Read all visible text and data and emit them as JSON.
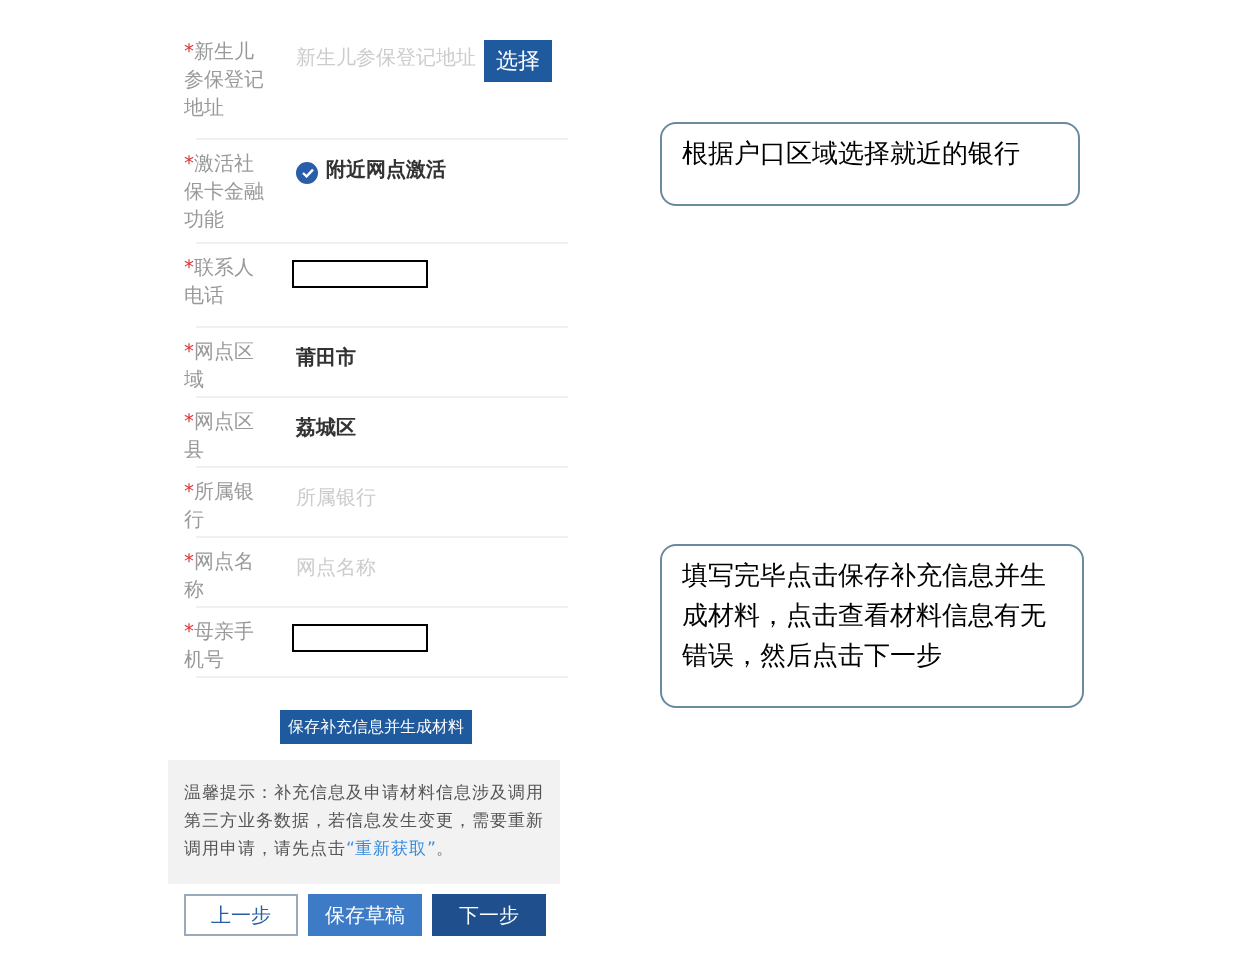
{
  "fields": [
    {
      "kind": "address",
      "marker": "*",
      "label": "新生儿参保登记地址",
      "placeholder": "新生儿参保登记地址",
      "button": "选择"
    },
    {
      "kind": "radio",
      "marker": "*",
      "label": "激活社保卡金融功能",
      "option": "附近网点激活",
      "checked": true
    },
    {
      "kind": "input",
      "marker": "*",
      "label": "联系人电话"
    },
    {
      "kind": "value",
      "marker": "*",
      "label": "网点区域",
      "value": "莆田市"
    },
    {
      "kind": "value",
      "marker": "*",
      "label": "网点区县",
      "value": "荔城区"
    },
    {
      "kind": "placeholder",
      "marker": "*",
      "label": "所属银行",
      "placeholder": "所属银行"
    },
    {
      "kind": "placeholder",
      "marker": "*",
      "label": "网点名称",
      "placeholder": "网点名称"
    },
    {
      "kind": "input",
      "marker": "*",
      "label": "母亲手机号"
    }
  ],
  "generate_button": "保存补充信息并生成材料",
  "notice": {
    "text": "温馨提示：补充信息及申请材料信息涉及调用第三方业务数据，若信息发生变更，需要重新调用申请，请先点击",
    "link": "“重新获取”",
    "end": "。"
  },
  "footer_buttons": [
    {
      "label": "上一步",
      "kind": "outline"
    },
    {
      "label": "保存草稿",
      "kind": "light"
    },
    {
      "label": "下一步",
      "kind": "primary"
    }
  ],
  "callouts": [
    "根据户口区域选择就近的银行",
    "填写完毕点击保存补充信息并生成材料，点击查看材料信息有无错误，然后点击下一步"
  ]
}
